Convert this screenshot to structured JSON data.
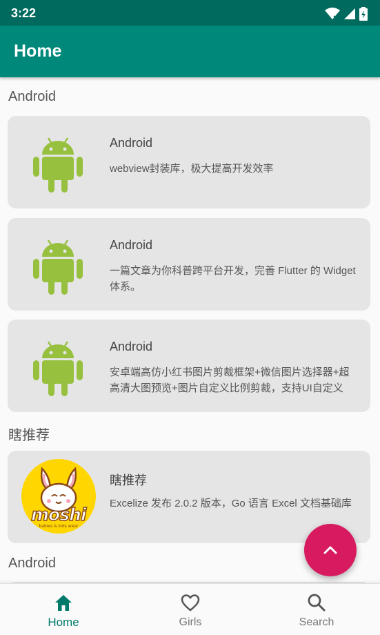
{
  "status_bar": {
    "time": "3:22"
  },
  "app_bar": {
    "title": "Home"
  },
  "sections": [
    {
      "title": "Android"
    },
    {
      "title": "瞎推荐"
    },
    {
      "title": "Android"
    }
  ],
  "cards": [
    {
      "title": "Android",
      "desc": "webview封装库，极大提高开发效率",
      "icon": "android-robot-icon"
    },
    {
      "title": "Android",
      "desc": "一篇文章为你科普跨平台开发，完善 Flutter 的 Widget 体系。",
      "icon": "android-robot-icon"
    },
    {
      "title": "Android",
      "desc": "安卓端高仿小红书图片剪裁框架+微信图片选择器+超高清大图预览+图片自定义比例剪裁，支持UI自定义",
      "icon": "android-robot-icon"
    },
    {
      "title": "瞎推荐",
      "desc": "Excelize 发布 2.0.2 版本，Go 语言 Excel 文档基础库",
      "icon": "moshi-logo",
      "logo_text": "moshi",
      "logo_sub": "babies & kids wear"
    }
  ],
  "fab": {
    "icon": "chevron-up-icon"
  },
  "bottom_nav": {
    "items": [
      {
        "label": "Home",
        "icon": "home-icon",
        "active": true
      },
      {
        "label": "Girls",
        "icon": "heart-outline-icon",
        "active": false
      },
      {
        "label": "Search",
        "icon": "search-icon",
        "active": false
      }
    ]
  },
  "colors": {
    "status_bar": "#006a5e",
    "app_bar": "#00897b",
    "fab": "#d81b60",
    "active_nav": "#00796b",
    "android_green": "#97c03e",
    "logo_yellow": "#ffd600"
  }
}
